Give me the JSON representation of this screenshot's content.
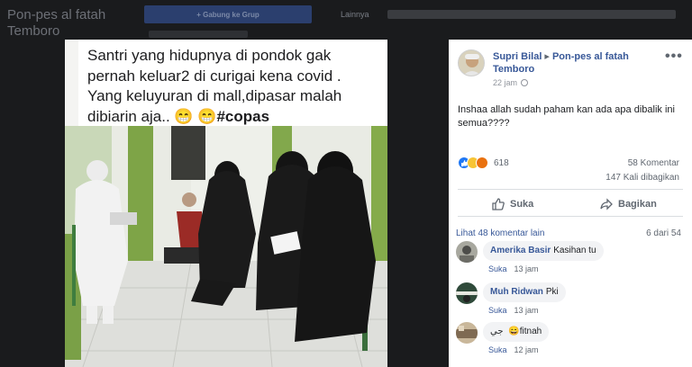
{
  "background": {
    "group_title": "Pon-pes al fatah Temboro",
    "join_button": "+ Gabung ke Grup",
    "about_link": "Lainnya"
  },
  "photo": {
    "caption_line1": "Santri yang hidupnya di pondok gak",
    "caption_line2": "pernah keluar2 di curigai kena covid .",
    "caption_line3": "Yang keluyuran di mall,dipasar malah",
    "caption_line4": "dibiarin aja..",
    "caption_emoji": "😁 😁",
    "caption_tag": "#copas"
  },
  "post": {
    "author": "Supri Bilal",
    "group": "Pon-pes al fatah Temboro",
    "separator": "▸",
    "more_icon": "•••",
    "time": "22 jam",
    "text": "Inshaa allah sudah paham kan ada apa dibalik ini semua????",
    "reactions_count": "618",
    "comments_count": "58 Komentar",
    "shares_count": "147 Kali dibagikan",
    "like_label": "Suka",
    "share_label": "Bagikan",
    "view_more": "Lihat 48 komentar lain",
    "page_count": "6 dari 54"
  },
  "comments": [
    {
      "name": "Amerika Basir",
      "text": "Kasihan tu",
      "like": "Suka",
      "time": "13 jam"
    },
    {
      "name": "Muh Ridwan",
      "text": "Pki",
      "like": "Suka",
      "time": "13 jam"
    },
    {
      "name": "",
      "text": "جي 😄fitnah",
      "like": "Suka",
      "time": "12 jam"
    }
  ],
  "colors": {
    "link": "#385898",
    "like_reaction": "#2078f4",
    "page_bg": "#1a1b1d"
  }
}
